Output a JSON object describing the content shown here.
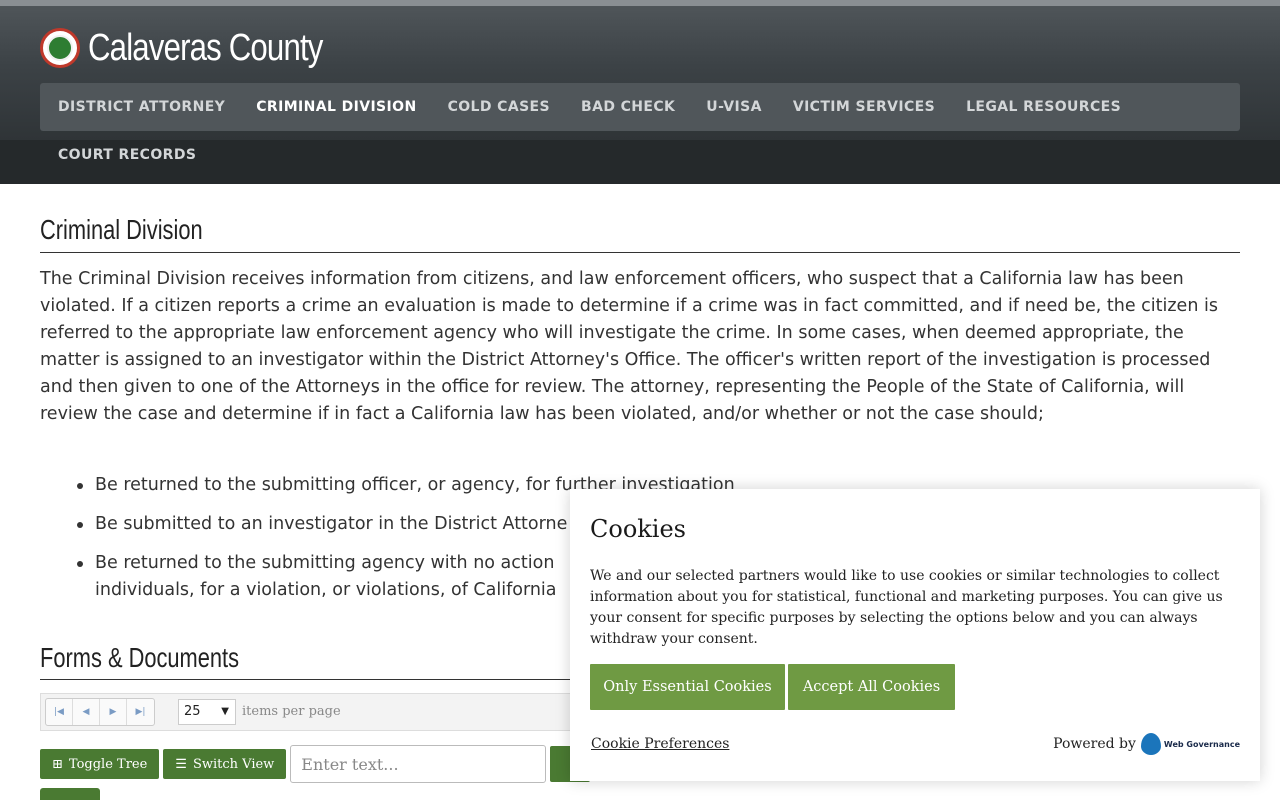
{
  "header": {
    "site_title": "Calaveras County",
    "nav": [
      {
        "label": "DISTRICT ATTORNEY",
        "active": false
      },
      {
        "label": "CRIMINAL DIVISION",
        "active": true
      },
      {
        "label": "COLD CASES",
        "active": false
      },
      {
        "label": "BAD CHECK",
        "active": false
      },
      {
        "label": "U-VISA",
        "active": false
      },
      {
        "label": "VICTIM SERVICES",
        "active": false
      },
      {
        "label": "LEGAL RESOURCES",
        "active": false
      },
      {
        "label": "COURT RECORDS",
        "active": false
      }
    ]
  },
  "main": {
    "title": "Criminal Division",
    "intro": "The Criminal Division receives information from citizens, and law enforcement officers, who suspect that a California law has been violated. If a citizen reports a crime an evaluation is made to determine if a crime was in fact committed, and if need be, the citizen is referred to the appropriate law enforcement agency who will investigate the crime. In some cases, when deemed appropriate, the matter is assigned to an investigator within the District Attorney's Office. The officer's written report of the investigation is processed and then given to one of the Attorneys in the office for review. The attorney, representing the People of the State of California, will review the case and determine if in fact a California law has been violated, and/or whether or not the case should;",
    "bullets": [
      "Be returned to the submitting officer, or agency, for further investigation",
      "Be submitted to an investigator in the District Attorne",
      "Be returned to the submitting agency with no action",
      "individuals, for a violation, or violations, of California"
    ],
    "forms_title": "Forms & Documents"
  },
  "grid": {
    "page_size": "25",
    "page_size_label": "items per page",
    "toggle_tree_label": "Toggle Tree",
    "switch_view_label": "Switch View",
    "search_placeholder": "Enter text..."
  },
  "cookie": {
    "title": "Cookies",
    "text": "We and our selected partners would like to use cookies or similar technologies to collect information about you for statistical, functional and marketing purposes. You can give us your consent for specific purposes by selecting the options below and you can always withdraw your consent.",
    "essential_label": "Only Essential Cookies",
    "accept_label": "Accept All Cookies",
    "preferences_label": "Cookie Preferences",
    "powered_by": "Powered by",
    "brand": "Web Governance"
  },
  "colors": {
    "accent_green": "#4a7a32",
    "cookie_button": "#6f9a43",
    "header_dark": "#3c4246"
  }
}
